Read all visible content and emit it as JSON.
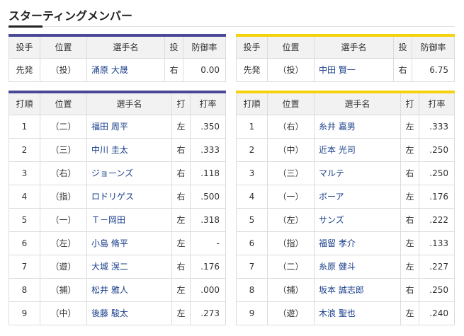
{
  "title": "スターティングメンバー",
  "colors": {
    "home_accent": "#4b4897",
    "away_accent": "#f6d20e"
  },
  "pitcher_headers": [
    "投手",
    "位置",
    "選手名",
    "投",
    "防御率"
  ],
  "batter_headers": [
    "打順",
    "位置",
    "選手名",
    "打",
    "打率"
  ],
  "left": {
    "pitcher": {
      "role": "先発",
      "pos": "（投）",
      "name": "涌原 大晟",
      "hand": "右",
      "era": "0.00"
    },
    "batters": [
      {
        "order": "1",
        "pos": "（二）",
        "name": "福田 周平",
        "hand": "左",
        "avg": ".350"
      },
      {
        "order": "2",
        "pos": "（三）",
        "name": "中川 圭太",
        "hand": "右",
        "avg": ".333"
      },
      {
        "order": "3",
        "pos": "（右）",
        "name": "ジョーンズ",
        "hand": "右",
        "avg": ".118"
      },
      {
        "order": "4",
        "pos": "（指）",
        "name": "ロドリゲス",
        "hand": "右",
        "avg": ".500"
      },
      {
        "order": "5",
        "pos": "（一）",
        "name": "Ｔ－岡田",
        "hand": "左",
        "avg": ".318"
      },
      {
        "order": "6",
        "pos": "（左）",
        "name": "小島 脩平",
        "hand": "左",
        "avg": "-"
      },
      {
        "order": "7",
        "pos": "（遊）",
        "name": "大城 滉二",
        "hand": "右",
        "avg": ".176"
      },
      {
        "order": "8",
        "pos": "（捕）",
        "name": "松井 雅人",
        "hand": "左",
        "avg": ".000"
      },
      {
        "order": "9",
        "pos": "（中）",
        "name": "後藤 駿太",
        "hand": "左",
        "avg": ".273"
      }
    ]
  },
  "right": {
    "pitcher": {
      "role": "先発",
      "pos": "（投）",
      "name": "中田 賢一",
      "hand": "右",
      "era": "6.75"
    },
    "batters": [
      {
        "order": "1",
        "pos": "（右）",
        "name": "糸井 嘉男",
        "hand": "左",
        "avg": ".333"
      },
      {
        "order": "2",
        "pos": "（中）",
        "name": "近本 光司",
        "hand": "左",
        "avg": ".250"
      },
      {
        "order": "3",
        "pos": "（三）",
        "name": "マルテ",
        "hand": "右",
        "avg": ".250"
      },
      {
        "order": "4",
        "pos": "（一）",
        "name": "ボーア",
        "hand": "左",
        "avg": ".176"
      },
      {
        "order": "5",
        "pos": "（左）",
        "name": "サンズ",
        "hand": "右",
        "avg": ".222"
      },
      {
        "order": "6",
        "pos": "（指）",
        "name": "福留 孝介",
        "hand": "左",
        "avg": ".133"
      },
      {
        "order": "7",
        "pos": "（二）",
        "name": "糸原 健斗",
        "hand": "左",
        "avg": ".227"
      },
      {
        "order": "8",
        "pos": "（捕）",
        "name": "坂本 誠志郎",
        "hand": "右",
        "avg": ".250"
      },
      {
        "order": "9",
        "pos": "（遊）",
        "name": "木浪 聖也",
        "hand": "左",
        "avg": ".240"
      }
    ]
  }
}
